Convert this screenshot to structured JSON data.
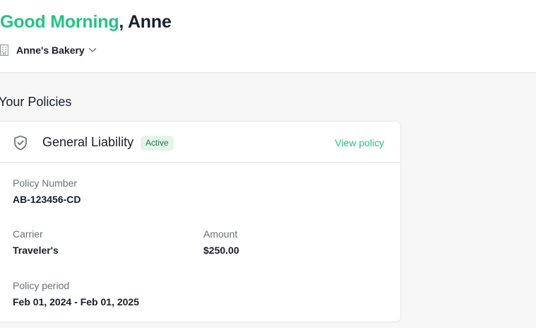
{
  "header": {
    "greeting_highlight": "Good Morning",
    "greeting_rest": ", Anne",
    "business_name": "Anne's Bakery",
    "business_icon": "building-icon",
    "dropdown_icon": "chevron-down-icon"
  },
  "section": {
    "title": "Your Policies"
  },
  "policy": {
    "icon": "shield-check-icon",
    "name": "General Liability",
    "status": "Active",
    "view_label": "View policy",
    "fields": {
      "policy_number_label": "Policy Number",
      "policy_number": "AB-123456-CD",
      "carrier_label": "Carrier",
      "carrier": "Traveler's",
      "amount_label": "Amount",
      "amount": "$250.00",
      "period_label": "Policy period",
      "period": "Feb 01, 2024 - Feb 01, 2025"
    }
  },
  "colors": {
    "accent": "#22c483",
    "badge_bg": "#e2f6ea",
    "badge_text": "#1c7a47",
    "text": "#1a1e2c",
    "muted": "#6b6f7b"
  }
}
